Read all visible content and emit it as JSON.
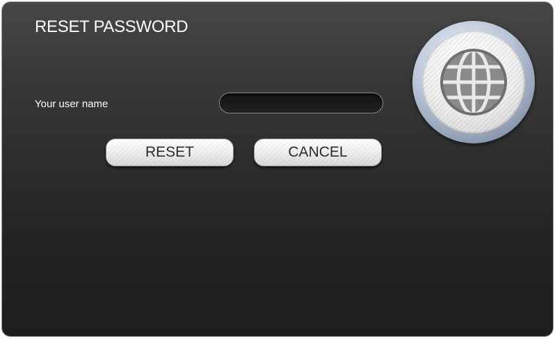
{
  "dialog": {
    "title": "RESET PASSWORD"
  },
  "form": {
    "username_label": "Your user name",
    "username_value": "",
    "username_placeholder": ""
  },
  "buttons": {
    "reset_label": "RESET",
    "cancel_label": "CANCEL"
  },
  "icons": {
    "emblem": "globe-icon"
  },
  "colors": {
    "dialog_background": "#2b2b2b",
    "button_face": "#f0f0f0",
    "title_text": "#ffffff",
    "globe_rim": "#b9c6d8"
  }
}
